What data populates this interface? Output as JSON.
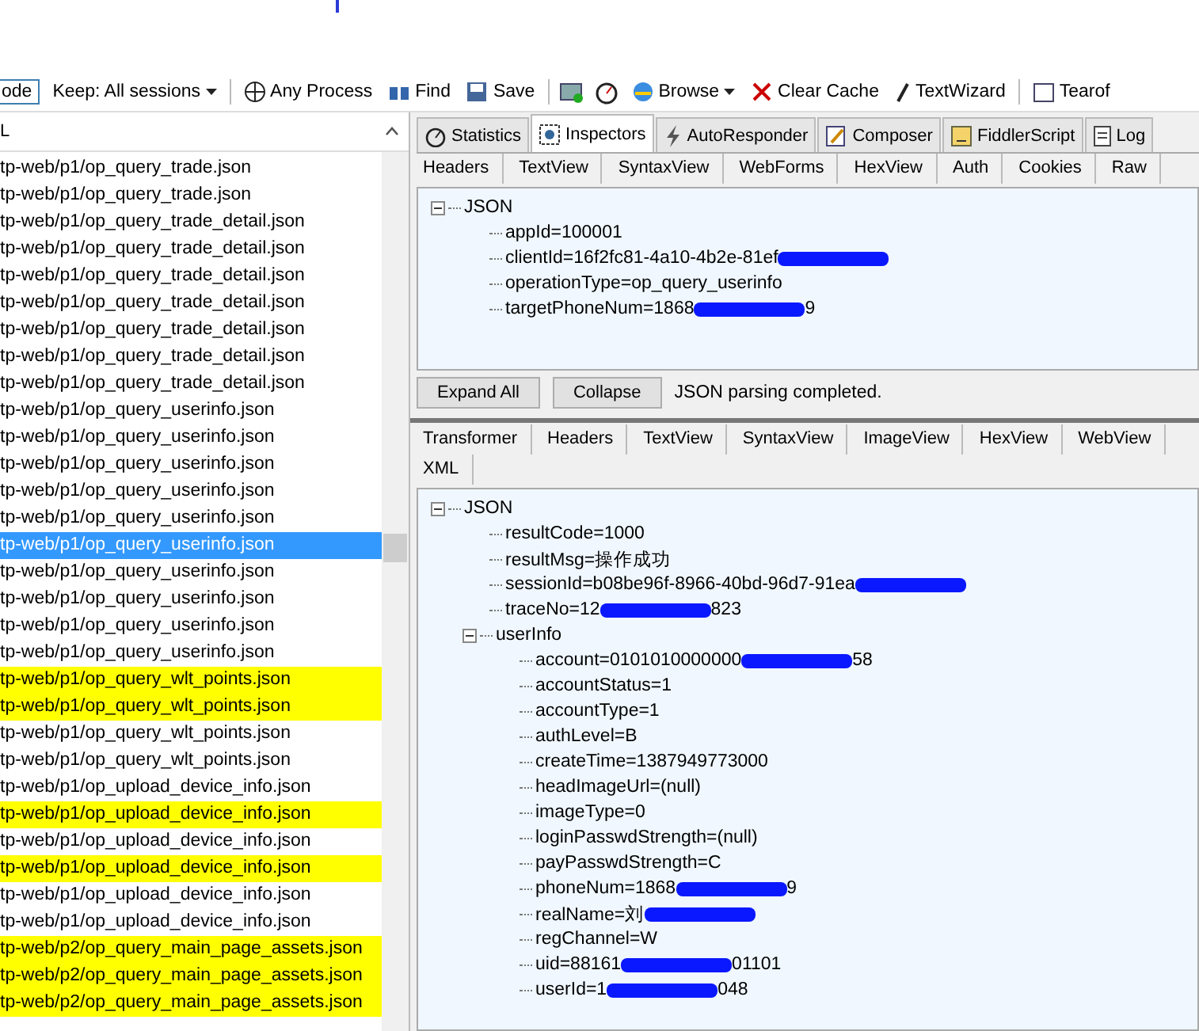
{
  "toolbar": {
    "items": [
      {
        "label": "ode",
        "kind": "button"
      },
      {
        "label": "Keep: All sessions",
        "kind": "dropdown"
      },
      {
        "label": "Any Process",
        "kind": "crosshair"
      },
      {
        "label": "Find",
        "kind": "find"
      },
      {
        "label": "Save",
        "kind": "save"
      },
      {
        "kind": "camera"
      },
      {
        "kind": "timer"
      },
      {
        "label": "Browse",
        "kind": "browse"
      },
      {
        "label": "Clear Cache",
        "kind": "clear"
      },
      {
        "label": "TextWizard",
        "kind": "wizard"
      },
      {
        "label": "Tearof",
        "kind": "tearoff"
      }
    ]
  },
  "sessions": {
    "column": "L",
    "rows": [
      {
        "url": "tp-web/p1/op_query_trade.json",
        "selected": false,
        "highlighted": false
      },
      {
        "url": "tp-web/p1/op_query_trade.json",
        "selected": false,
        "highlighted": false
      },
      {
        "url": "tp-web/p1/op_query_trade_detail.json",
        "selected": false,
        "highlighted": false
      },
      {
        "url": "tp-web/p1/op_query_trade_detail.json",
        "selected": false,
        "highlighted": false
      },
      {
        "url": "tp-web/p1/op_query_trade_detail.json",
        "selected": false,
        "highlighted": false
      },
      {
        "url": "tp-web/p1/op_query_trade_detail.json",
        "selected": false,
        "highlighted": false
      },
      {
        "url": "tp-web/p1/op_query_trade_detail.json",
        "selected": false,
        "highlighted": false
      },
      {
        "url": "tp-web/p1/op_query_trade_detail.json",
        "selected": false,
        "highlighted": false
      },
      {
        "url": "tp-web/p1/op_query_trade_detail.json",
        "selected": false,
        "highlighted": false
      },
      {
        "url": "tp-web/p1/op_query_userinfo.json",
        "selected": false,
        "highlighted": false
      },
      {
        "url": "tp-web/p1/op_query_userinfo.json",
        "selected": false,
        "highlighted": false
      },
      {
        "url": "tp-web/p1/op_query_userinfo.json",
        "selected": false,
        "highlighted": false
      },
      {
        "url": "tp-web/p1/op_query_userinfo.json",
        "selected": false,
        "highlighted": false
      },
      {
        "url": "tp-web/p1/op_query_userinfo.json",
        "selected": false,
        "highlighted": false
      },
      {
        "url": "tp-web/p1/op_query_userinfo.json",
        "selected": true,
        "highlighted": false
      },
      {
        "url": "tp-web/p1/op_query_userinfo.json",
        "selected": false,
        "highlighted": false
      },
      {
        "url": "tp-web/p1/op_query_userinfo.json",
        "selected": false,
        "highlighted": false
      },
      {
        "url": "tp-web/p1/op_query_userinfo.json",
        "selected": false,
        "highlighted": false
      },
      {
        "url": "tp-web/p1/op_query_userinfo.json",
        "selected": false,
        "highlighted": false
      },
      {
        "url": "tp-web/p1/op_query_wlt_points.json",
        "selected": false,
        "highlighted": true
      },
      {
        "url": "tp-web/p1/op_query_wlt_points.json",
        "selected": false,
        "highlighted": true
      },
      {
        "url": "tp-web/p1/op_query_wlt_points.json",
        "selected": false,
        "highlighted": false
      },
      {
        "url": "tp-web/p1/op_query_wlt_points.json",
        "selected": false,
        "highlighted": false
      },
      {
        "url": "tp-web/p1/op_upload_device_info.json",
        "selected": false,
        "highlighted": false
      },
      {
        "url": "tp-web/p1/op_upload_device_info.json",
        "selected": false,
        "highlighted": true
      },
      {
        "url": "tp-web/p1/op_upload_device_info.json",
        "selected": false,
        "highlighted": false
      },
      {
        "url": "tp-web/p1/op_upload_device_info.json",
        "selected": false,
        "highlighted": true
      },
      {
        "url": "tp-web/p1/op_upload_device_info.json",
        "selected": false,
        "highlighted": false
      },
      {
        "url": "tp-web/p1/op_upload_device_info.json",
        "selected": false,
        "highlighted": false
      },
      {
        "url": "tp-web/p2/op_query_main_page_assets.json",
        "selected": false,
        "highlighted": true
      },
      {
        "url": "tp-web/p2/op_query_main_page_assets.json",
        "selected": false,
        "highlighted": true
      },
      {
        "url": "tp-web/p2/op_query_main_page_assets.json",
        "selected": false,
        "highlighted": true
      }
    ]
  },
  "main_tabs": [
    {
      "label": "Statistics",
      "kind": "timer",
      "selected": false
    },
    {
      "label": "Inspectors",
      "kind": "inspect",
      "selected": true
    },
    {
      "label": "AutoResponder",
      "kind": "bolt",
      "selected": false
    },
    {
      "label": "Composer",
      "kind": "pencil",
      "selected": false
    },
    {
      "label": "FiddlerScript",
      "kind": "script",
      "selected": false
    },
    {
      "label": "Log",
      "kind": "log",
      "selected": false
    }
  ],
  "request": {
    "tabs": [
      {
        "label": "Headers",
        "selected": false
      },
      {
        "label": "TextView",
        "selected": false
      },
      {
        "label": "SyntaxView",
        "selected": false
      },
      {
        "label": "WebForms",
        "selected": false
      },
      {
        "label": "HexView",
        "selected": false
      },
      {
        "label": "Auth",
        "selected": false
      },
      {
        "label": "Cookies",
        "selected": false
      },
      {
        "label": "Raw",
        "selected": false
      }
    ],
    "tree": {
      "label": "JSON",
      "expanded": true,
      "children": [
        {
          "label": "appId=100001",
          "redacted": false
        },
        {
          "label": "clientId=16f2fc81-4a10-4b2e-81ef",
          "redacted": true
        },
        {
          "label": "operationType=op_query_userinfo",
          "redacted": false
        },
        {
          "label": "targetPhoneNum=1868",
          "redacted": true,
          "tail": "9"
        }
      ]
    },
    "buttons": [
      "Expand All",
      "Collapse"
    ],
    "status": "JSON parsing completed."
  },
  "response": {
    "tabs": [
      {
        "label": "Transformer",
        "selected": false
      },
      {
        "label": "Headers",
        "selected": false
      },
      {
        "label": "TextView",
        "selected": false
      },
      {
        "label": "SyntaxView",
        "selected": false
      },
      {
        "label": "ImageView",
        "selected": false
      },
      {
        "label": "HexView",
        "selected": false
      },
      {
        "label": "WebView",
        "selected": false
      },
      {
        "label": "XML",
        "selected": false
      }
    ],
    "tree": {
      "label": "JSON",
      "expanded": true,
      "children": [
        {
          "label": "resultCode=1000",
          "redacted": false
        },
        {
          "label": "resultMsg=操作成功",
          "redacted": false
        },
        {
          "label": "sessionId=b08be96f-8966-40bd-96d7-91ea",
          "redacted": true
        },
        {
          "label": "traceNo=12",
          "redacted": true,
          "tail": "823"
        },
        {
          "label": "userInfo",
          "expanded": true,
          "children": [
            {
              "label": "account=0101010000000",
              "redacted": true,
              "tail": "58"
            },
            {
              "label": "accountStatus=1",
              "redacted": false
            },
            {
              "label": "accountType=1",
              "redacted": false
            },
            {
              "label": "authLevel=B",
              "redacted": false
            },
            {
              "label": "createTime=1387949773000",
              "redacted": false
            },
            {
              "label": "headImageUrl=(null)",
              "redacted": false
            },
            {
              "label": "imageType=0",
              "redacted": false
            },
            {
              "label": "loginPasswdStrength=(null)",
              "redacted": false
            },
            {
              "label": "payPasswdStrength=C",
              "redacted": false
            },
            {
              "label": "phoneNum=1868",
              "redacted": true,
              "tail": "9"
            },
            {
              "label": "realName=刘",
              "redacted": true
            },
            {
              "label": "regChannel=W",
              "redacted": false
            },
            {
              "label": "uid=88161",
              "redacted": true,
              "tail": "01101"
            },
            {
              "label": "userId=1",
              "redacted": true,
              "tail": "048"
            }
          ]
        }
      ]
    }
  }
}
